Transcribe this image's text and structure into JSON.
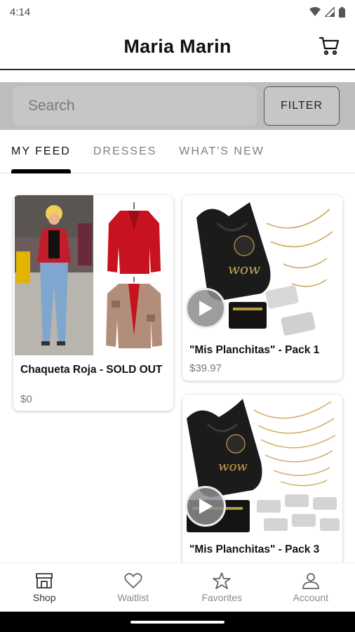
{
  "status_bar": {
    "time": "4:14"
  },
  "header": {
    "title": "Maria Marin"
  },
  "search": {
    "placeholder": "Search",
    "filter_label": "FILTER"
  },
  "tabs": [
    {
      "label": "MY FEED",
      "active": true
    },
    {
      "label": "DRESSES",
      "active": false
    },
    {
      "label": "WHAT'S NEW",
      "active": false
    }
  ],
  "products": [
    {
      "title": "Chaqueta Roja  - SOLD OUT",
      "price": "$0",
      "has_video": false
    },
    {
      "title": "\"Mis Planchitas\" - Pack 1",
      "price": "$39.97",
      "has_video": true
    },
    {
      "title": "\"Mis Planchitas\" - Pack 3",
      "price": "",
      "has_video": true
    }
  ],
  "bottom_nav": [
    {
      "label": "Shop",
      "icon": "store-icon",
      "active": true
    },
    {
      "label": "Waitlist",
      "icon": "heart-icon",
      "active": false
    },
    {
      "label": "Favorites",
      "icon": "star-icon",
      "active": false
    },
    {
      "label": "Account",
      "icon": "person-icon",
      "active": false
    }
  ],
  "colors": {
    "accent": "#000000",
    "search_bg": "#bdbdbd",
    "inactive_text": "#888888"
  }
}
